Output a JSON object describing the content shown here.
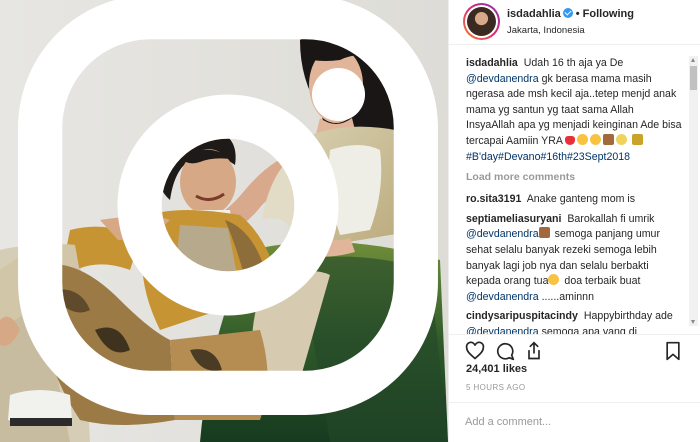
{
  "post": {
    "author": {
      "handle": "isdadahlia",
      "follow_state": "Following",
      "location": "Jakarta, Indonesia",
      "verified_icon": "verified-badge-icon"
    },
    "caption": {
      "user": "isdadahlia",
      "text_a": "Udah 16 th aja ya De",
      "mention": "@devdanendra",
      "text_b": "gk berasa mama masih ngerasa ade msh kecil aja..tetep menjd anak mama yg santun yg taat sama Allah InsyaAllah apa yg menjadi keinginan Ade bisa tercapai Aamiin YRA",
      "tags": "#B'day#Devano#16th#23Sept2018"
    },
    "load_more": "Load more comments",
    "comments": [
      {
        "user": "ro.sita3191",
        "text": "Anake ganteng mom is"
      },
      {
        "user": "septiameliasuryani",
        "text_a": "Barokallah fi umrik",
        "mention": "@devdanendra",
        "text_b": "semoga panjang umur sehat selalu banyak rezeki semoga lebih banyak lagi job nya dan selalu berbakti kepada orang tua",
        "text_c": "doa terbaik buat",
        "mention2": "@devdanendra",
        "text_d": "......aminnn"
      },
      {
        "user": "cindysaripuspitacindy",
        "text_a": "Happybirthday ade",
        "mention": "@devdanendra",
        "text_b": "semoga apa yang di diinginkan di jabah oleh allah swt"
      }
    ],
    "likes": "24,401 likes",
    "time": "5 HOURS AGO",
    "add_comment_placeholder": "Add a comment...",
    "icons": {
      "like": "heart-icon",
      "comment": "comment-icon",
      "share": "share-icon",
      "save": "bookmark-icon",
      "photo_badge": "instagram-icon"
    },
    "colors": {
      "mention": "#003569",
      "verified": "#3897f0",
      "muted": "#999999"
    }
  }
}
